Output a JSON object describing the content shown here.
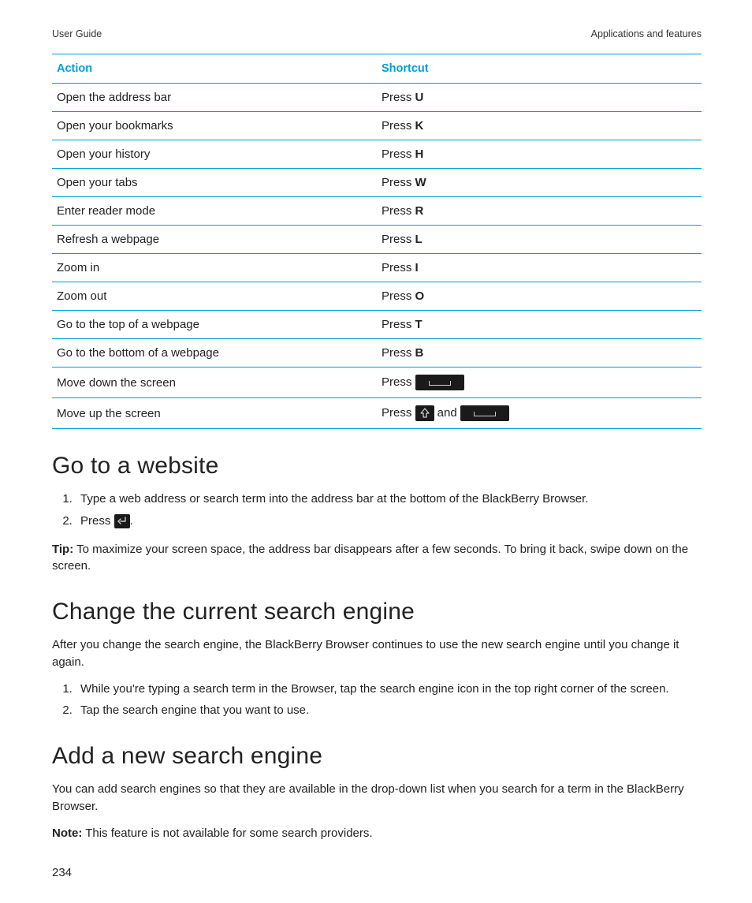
{
  "header": {
    "left": "User Guide",
    "right": "Applications and features"
  },
  "table": {
    "headers": {
      "action": "Action",
      "shortcut": "Shortcut"
    },
    "press": "Press",
    "and": "and",
    "rows": [
      {
        "action": "Open the address bar",
        "key": "U",
        "type": "letter"
      },
      {
        "action": "Open your bookmarks",
        "key": "K",
        "type": "letter"
      },
      {
        "action": "Open your history",
        "key": "H",
        "type": "letter"
      },
      {
        "action": "Open your tabs",
        "key": "W",
        "type": "letter"
      },
      {
        "action": "Enter reader mode",
        "key": "R",
        "type": "letter"
      },
      {
        "action": "Refresh a webpage",
        "key": "L",
        "type": "letter"
      },
      {
        "action": "Zoom in",
        "key": "I",
        "type": "letter"
      },
      {
        "action": "Zoom out",
        "key": "O",
        "type": "letter"
      },
      {
        "action": "Go to the top of a webpage",
        "key": "T",
        "type": "letter"
      },
      {
        "action": "Go to the bottom of a webpage",
        "key": "B",
        "type": "letter"
      },
      {
        "action": "Move down the screen",
        "type": "space"
      },
      {
        "action": "Move up the screen",
        "type": "shift_space"
      }
    ]
  },
  "sections": {
    "s1": {
      "heading": "Go to a website",
      "steps": [
        "Type a web address or search term into the address bar at the bottom of the BlackBerry Browser."
      ],
      "step2_prefix": "Press",
      "step2_suffix": ".",
      "tip_label": "Tip:",
      "tip_text": " To maximize your screen space, the address bar disappears after a few seconds. To bring it back, swipe down on the screen."
    },
    "s2": {
      "heading": "Change the current search engine",
      "intro": "After you change the search engine, the BlackBerry Browser continues to use the new search engine until you change it again.",
      "steps": [
        "While you're typing a search term in the Browser, tap the search engine icon in the top right corner of the screen.",
        "Tap the search engine that you want to use."
      ]
    },
    "s3": {
      "heading": "Add a new search engine",
      "intro": "You can add search engines so that they are available in the drop-down list when you search for a term in the BlackBerry Browser.",
      "note_label": "Note:",
      "note_text": " This feature is not available for some search providers."
    }
  },
  "pageNumber": "234"
}
